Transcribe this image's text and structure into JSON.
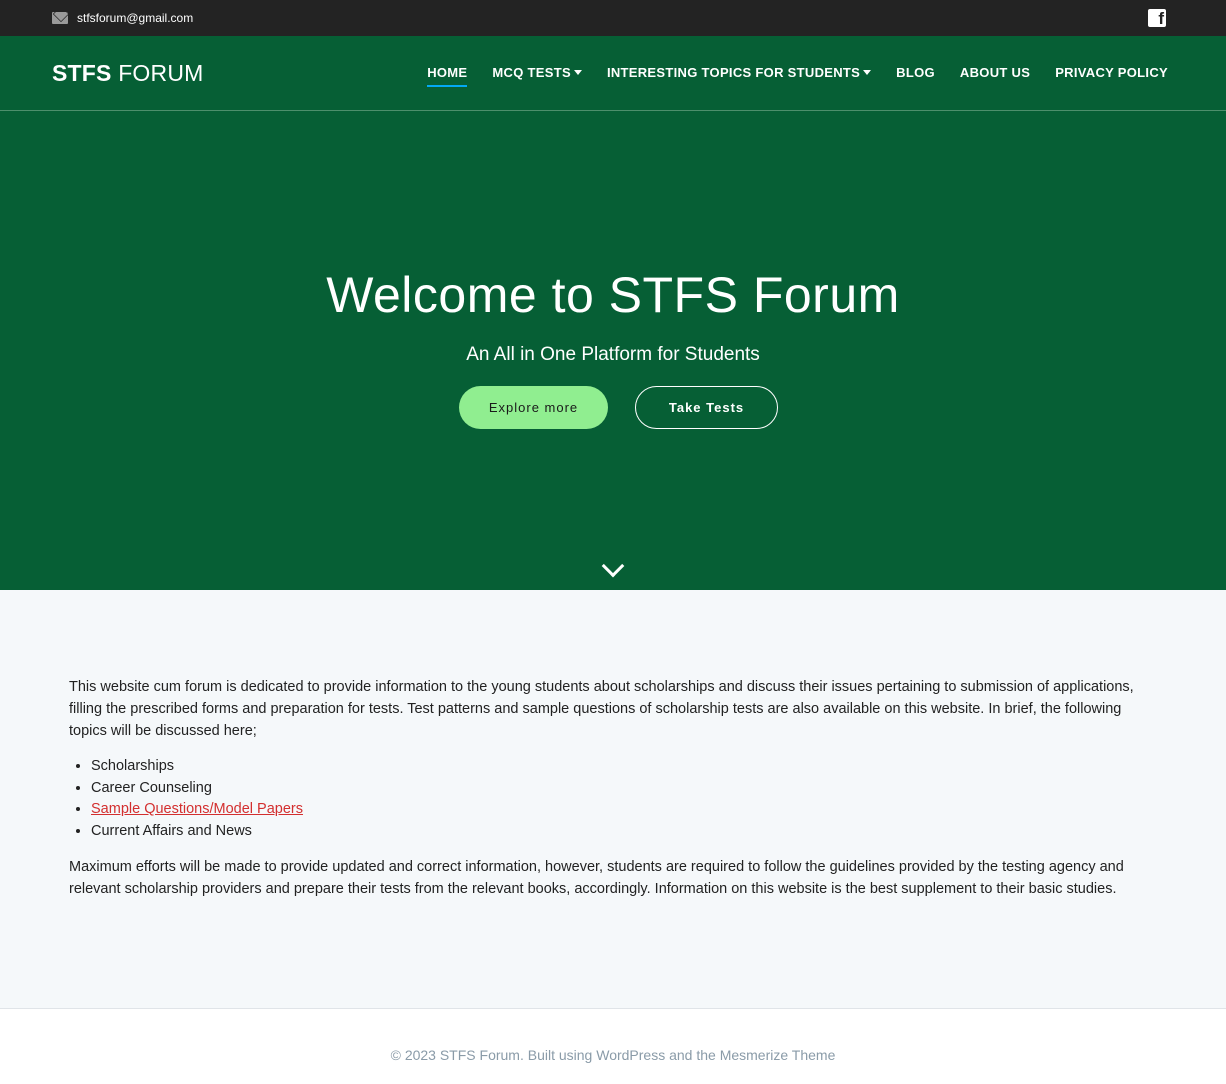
{
  "topbar": {
    "email": "stfsforum@gmail.com",
    "social_icon": "facebook-icon"
  },
  "nav": {
    "logo_bold": "STFS",
    "logo_light": "FORUM",
    "items": [
      {
        "label": "HOME",
        "active": true,
        "dropdown": false
      },
      {
        "label": "MCQ TESTS",
        "active": false,
        "dropdown": true
      },
      {
        "label": "INTERESTING TOPICS FOR STUDENTS",
        "active": false,
        "dropdown": true
      },
      {
        "label": "BLOG",
        "active": false,
        "dropdown": false
      },
      {
        "label": "ABOUT US",
        "active": false,
        "dropdown": false
      },
      {
        "label": "PRIVACY POLICY",
        "active": false,
        "dropdown": false
      }
    ]
  },
  "hero": {
    "title": "Welcome to STFS Forum",
    "subtitle": "An All in One Platform for Students",
    "primary_button": "Explore more",
    "secondary_button": "Take Tests",
    "background_color": "#065f35",
    "primary_button_color": "#90ee90"
  },
  "content": {
    "intro": "This website cum forum is dedicated to provide information to the young students about scholarships and discuss their issues pertaining to submission of applications, filling the prescribed forms and preparation for tests. Test patterns and sample questions of scholarship tests are also available on this website.  In brief, the following topics will be discussed here;",
    "topics": [
      "Scholarships",
      "Career Counseling",
      "Sample Questions/Model Papers",
      "Current Affairs and News"
    ],
    "outro": "Maximum efforts will be made to provide updated and correct information, however, students are required to follow the guidelines provided by the testing agency and relevant scholarship providers and prepare their tests from the relevant books, accordingly. Information on this website is the best supplement to their basic studies."
  },
  "footer": {
    "text": "©  2023 STFS Forum. Built using WordPress and the Mesmerize Theme"
  }
}
